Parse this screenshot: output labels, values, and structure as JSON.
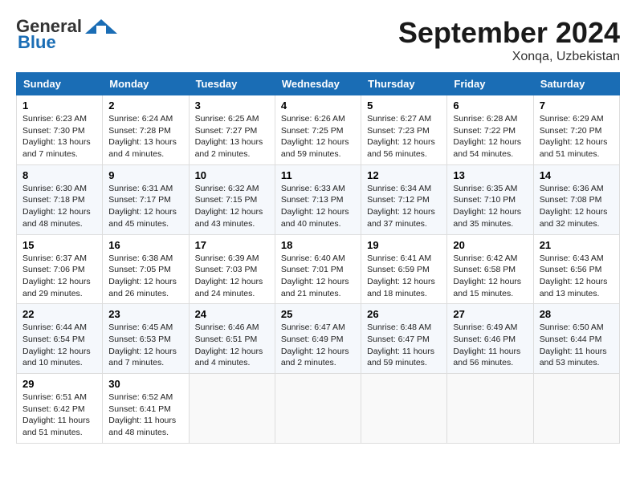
{
  "header": {
    "logo_general": "General",
    "logo_blue": "Blue",
    "month_title": "September 2024",
    "location": "Xonqa, Uzbekistan"
  },
  "weekdays": [
    "Sunday",
    "Monday",
    "Tuesday",
    "Wednesday",
    "Thursday",
    "Friday",
    "Saturday"
  ],
  "weeks": [
    [
      {
        "day": "1",
        "info": "Sunrise: 6:23 AM\nSunset: 7:30 PM\nDaylight: 13 hours and 7 minutes."
      },
      {
        "day": "2",
        "info": "Sunrise: 6:24 AM\nSunset: 7:28 PM\nDaylight: 13 hours and 4 minutes."
      },
      {
        "day": "3",
        "info": "Sunrise: 6:25 AM\nSunset: 7:27 PM\nDaylight: 13 hours and 2 minutes."
      },
      {
        "day": "4",
        "info": "Sunrise: 6:26 AM\nSunset: 7:25 PM\nDaylight: 12 hours and 59 minutes."
      },
      {
        "day": "5",
        "info": "Sunrise: 6:27 AM\nSunset: 7:23 PM\nDaylight: 12 hours and 56 minutes."
      },
      {
        "day": "6",
        "info": "Sunrise: 6:28 AM\nSunset: 7:22 PM\nDaylight: 12 hours and 54 minutes."
      },
      {
        "day": "7",
        "info": "Sunrise: 6:29 AM\nSunset: 7:20 PM\nDaylight: 12 hours and 51 minutes."
      }
    ],
    [
      {
        "day": "8",
        "info": "Sunrise: 6:30 AM\nSunset: 7:18 PM\nDaylight: 12 hours and 48 minutes."
      },
      {
        "day": "9",
        "info": "Sunrise: 6:31 AM\nSunset: 7:17 PM\nDaylight: 12 hours and 45 minutes."
      },
      {
        "day": "10",
        "info": "Sunrise: 6:32 AM\nSunset: 7:15 PM\nDaylight: 12 hours and 43 minutes."
      },
      {
        "day": "11",
        "info": "Sunrise: 6:33 AM\nSunset: 7:13 PM\nDaylight: 12 hours and 40 minutes."
      },
      {
        "day": "12",
        "info": "Sunrise: 6:34 AM\nSunset: 7:12 PM\nDaylight: 12 hours and 37 minutes."
      },
      {
        "day": "13",
        "info": "Sunrise: 6:35 AM\nSunset: 7:10 PM\nDaylight: 12 hours and 35 minutes."
      },
      {
        "day": "14",
        "info": "Sunrise: 6:36 AM\nSunset: 7:08 PM\nDaylight: 12 hours and 32 minutes."
      }
    ],
    [
      {
        "day": "15",
        "info": "Sunrise: 6:37 AM\nSunset: 7:06 PM\nDaylight: 12 hours and 29 minutes."
      },
      {
        "day": "16",
        "info": "Sunrise: 6:38 AM\nSunset: 7:05 PM\nDaylight: 12 hours and 26 minutes."
      },
      {
        "day": "17",
        "info": "Sunrise: 6:39 AM\nSunset: 7:03 PM\nDaylight: 12 hours and 24 minutes."
      },
      {
        "day": "18",
        "info": "Sunrise: 6:40 AM\nSunset: 7:01 PM\nDaylight: 12 hours and 21 minutes."
      },
      {
        "day": "19",
        "info": "Sunrise: 6:41 AM\nSunset: 6:59 PM\nDaylight: 12 hours and 18 minutes."
      },
      {
        "day": "20",
        "info": "Sunrise: 6:42 AM\nSunset: 6:58 PM\nDaylight: 12 hours and 15 minutes."
      },
      {
        "day": "21",
        "info": "Sunrise: 6:43 AM\nSunset: 6:56 PM\nDaylight: 12 hours and 13 minutes."
      }
    ],
    [
      {
        "day": "22",
        "info": "Sunrise: 6:44 AM\nSunset: 6:54 PM\nDaylight: 12 hours and 10 minutes."
      },
      {
        "day": "23",
        "info": "Sunrise: 6:45 AM\nSunset: 6:53 PM\nDaylight: 12 hours and 7 minutes."
      },
      {
        "day": "24",
        "info": "Sunrise: 6:46 AM\nSunset: 6:51 PM\nDaylight: 12 hours and 4 minutes."
      },
      {
        "day": "25",
        "info": "Sunrise: 6:47 AM\nSunset: 6:49 PM\nDaylight: 12 hours and 2 minutes."
      },
      {
        "day": "26",
        "info": "Sunrise: 6:48 AM\nSunset: 6:47 PM\nDaylight: 11 hours and 59 minutes."
      },
      {
        "day": "27",
        "info": "Sunrise: 6:49 AM\nSunset: 6:46 PM\nDaylight: 11 hours and 56 minutes."
      },
      {
        "day": "28",
        "info": "Sunrise: 6:50 AM\nSunset: 6:44 PM\nDaylight: 11 hours and 53 minutes."
      }
    ],
    [
      {
        "day": "29",
        "info": "Sunrise: 6:51 AM\nSunset: 6:42 PM\nDaylight: 11 hours and 51 minutes."
      },
      {
        "day": "30",
        "info": "Sunrise: 6:52 AM\nSunset: 6:41 PM\nDaylight: 11 hours and 48 minutes."
      },
      {
        "day": "",
        "info": ""
      },
      {
        "day": "",
        "info": ""
      },
      {
        "day": "",
        "info": ""
      },
      {
        "day": "",
        "info": ""
      },
      {
        "day": "",
        "info": ""
      }
    ]
  ]
}
